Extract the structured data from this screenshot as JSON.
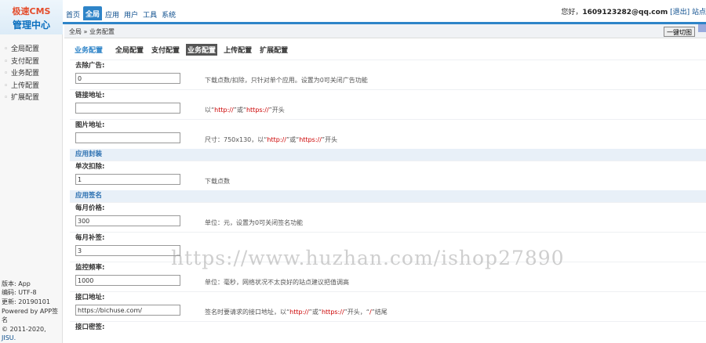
{
  "logo": {
    "line1": "极速CMS",
    "line2": "管理中心"
  },
  "topnav": [
    "首页",
    "全局",
    "应用",
    "用户",
    "工具",
    "系统"
  ],
  "user": {
    "greeting": "您好，",
    "email": "1609123282@qq.com",
    "logout": "[退出]",
    "site": "站点"
  },
  "breadcrumb": "全局 » 业务配置",
  "cut_button": "一键切图",
  "sidebar": {
    "items": [
      "全局配置",
      "支付配置",
      "业务配置",
      "上传配置",
      "扩展配置"
    ],
    "info": [
      "版本: App",
      "编码: UTF-8",
      "更新: 20190101",
      "Powered by APP签名",
      "© 2011-2020,"
    ],
    "jisu": "JISU."
  },
  "tabs": [
    "业务配置",
    "全局配置",
    "支付配置",
    "业务配置",
    "上传配置",
    "扩展配置"
  ],
  "form": {
    "remove_ad": {
      "label": "去除广告:",
      "value": "0",
      "hint": "下载点数/扣除，只针对单个应用。设置为0可关闭广告功能"
    },
    "link_url": {
      "label": "链接地址:",
      "value": "",
      "hint_pre": "以“",
      "hint_http": "http://",
      "hint_mid": "”或“",
      "hint_https": "https://",
      "hint_post": "”开头"
    },
    "image_url": {
      "label": "图片地址:",
      "value": "",
      "hint_pre": "尺寸：750x130，以“",
      "hint_http": "http://",
      "hint_mid": "”或“",
      "hint_https": "https://",
      "hint_post": "”开头"
    },
    "section_pack": "应用封装",
    "single_deduct": {
      "label": "单次扣除:",
      "value": "1",
      "hint": "下载点数"
    },
    "section_sign": "应用签名",
    "monthly_price": {
      "label": "每月价格:",
      "value": "300",
      "hint": "单位：元，设置为0可关闭签名功能"
    },
    "monthly_supplement": {
      "label": "每月补签:",
      "value": "3",
      "hint": ""
    },
    "monitor_freq": {
      "label": "监控频率:",
      "value": "1000",
      "hint": "单位：毫秒，网络状况不太良好的站点建议把值调高"
    },
    "api_url": {
      "label": "接口地址:",
      "value": "https://bichuse.com/",
      "hint_pre": "签名时要请求的接口地址，以“",
      "hint_http": "http://",
      "hint_mid": "”或“",
      "hint_https": "https://",
      "hint_post": "”开头，“",
      "hint_slash": "/",
      "hint_end": "”结尾"
    },
    "api_key": {
      "label": "接口密签:"
    }
  },
  "watermark": "https://www.huzhan.com/ishop27890"
}
